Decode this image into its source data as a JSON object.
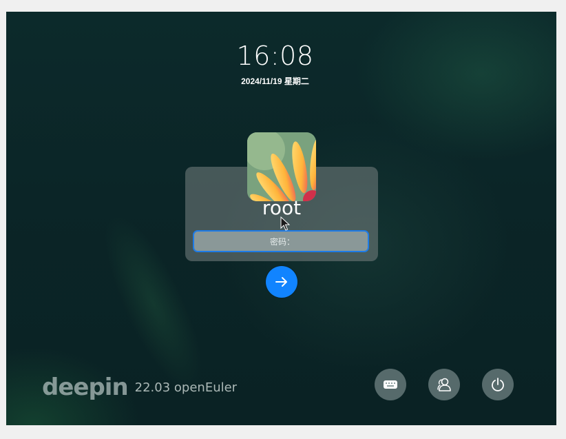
{
  "clock": {
    "time": "16:08",
    "date": "2024/11/19 星期二"
  },
  "user": {
    "name": "root",
    "avatar_icon": "flower-avatar"
  },
  "password": {
    "placeholder": "密码：",
    "value": ""
  },
  "submit": {
    "icon": "arrow-right-icon",
    "color": "#1184ff"
  },
  "brand": {
    "logo_text": "deepin",
    "version": "22.03 openEuler"
  },
  "controls": [
    {
      "icon": "keyboard-icon"
    },
    {
      "icon": "switch-user-icon"
    },
    {
      "icon": "power-icon"
    }
  ],
  "colors": {
    "accent": "#1184ff",
    "focus_border": "#1e7ce8"
  }
}
